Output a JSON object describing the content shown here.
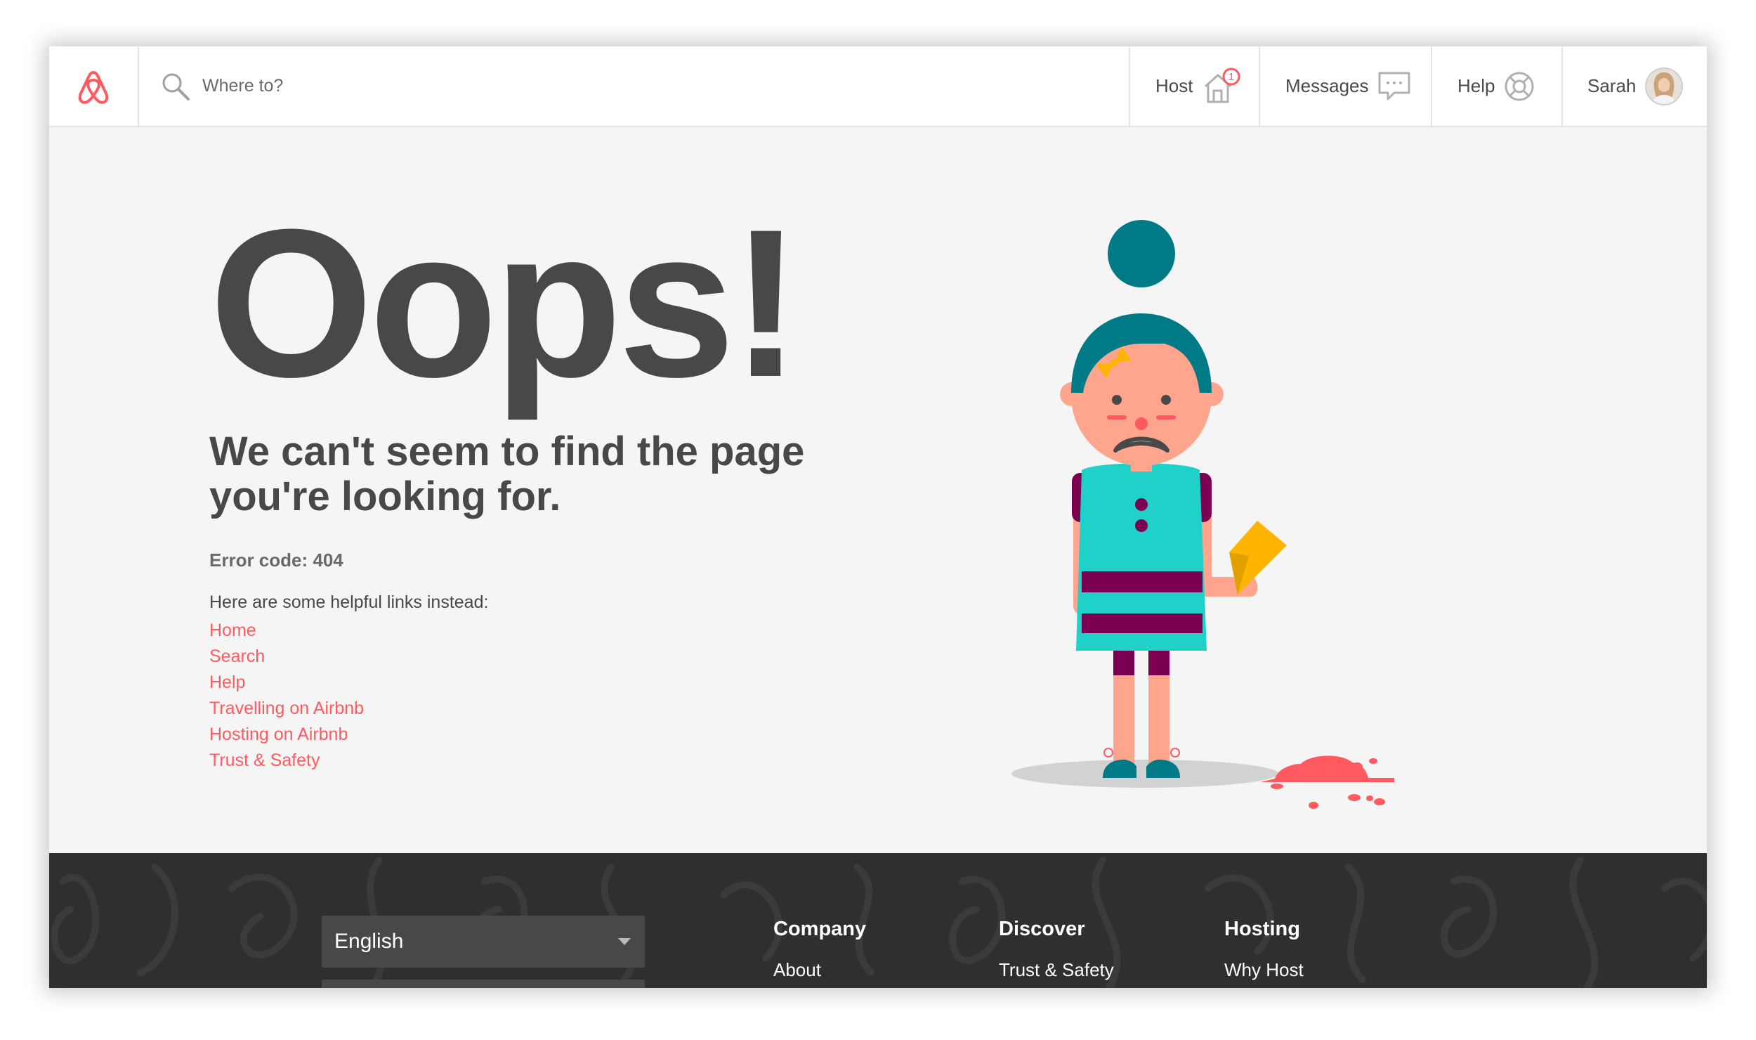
{
  "header": {
    "search_placeholder": "Where to?",
    "nav": {
      "host": "Host",
      "host_badge": "1",
      "messages": "Messages",
      "help": "Help",
      "user": "Sarah"
    }
  },
  "main": {
    "title": "Oops!",
    "subtitle": "We can't seem to find the page you're looking for.",
    "error_code": "Error code: 404",
    "links_intro": "Here are some helpful links instead:",
    "links": [
      "Home",
      "Search",
      "Help",
      "Travelling on Airbnb",
      "Hosting on Airbnb",
      "Trust & Safety"
    ]
  },
  "footer": {
    "language": "English",
    "columns": [
      {
        "heading": "Company",
        "link": "About"
      },
      {
        "heading": "Discover",
        "link": "Trust & Safety"
      },
      {
        "heading": "Hosting",
        "link": "Why Host"
      }
    ]
  },
  "colors": {
    "brand": "#ff5a5f",
    "text_dark": "#484848",
    "footer_bg": "#2f2f30",
    "girl_dress": "#1fd1c8",
    "girl_hair": "#007a87",
    "stripe": "#7b0051",
    "ice_cream": "#ffb400"
  },
  "icons": [
    "airbnb-logo-icon",
    "search-icon",
    "house-icon",
    "chat-bubble-icon",
    "lifebuoy-icon",
    "avatar"
  ]
}
